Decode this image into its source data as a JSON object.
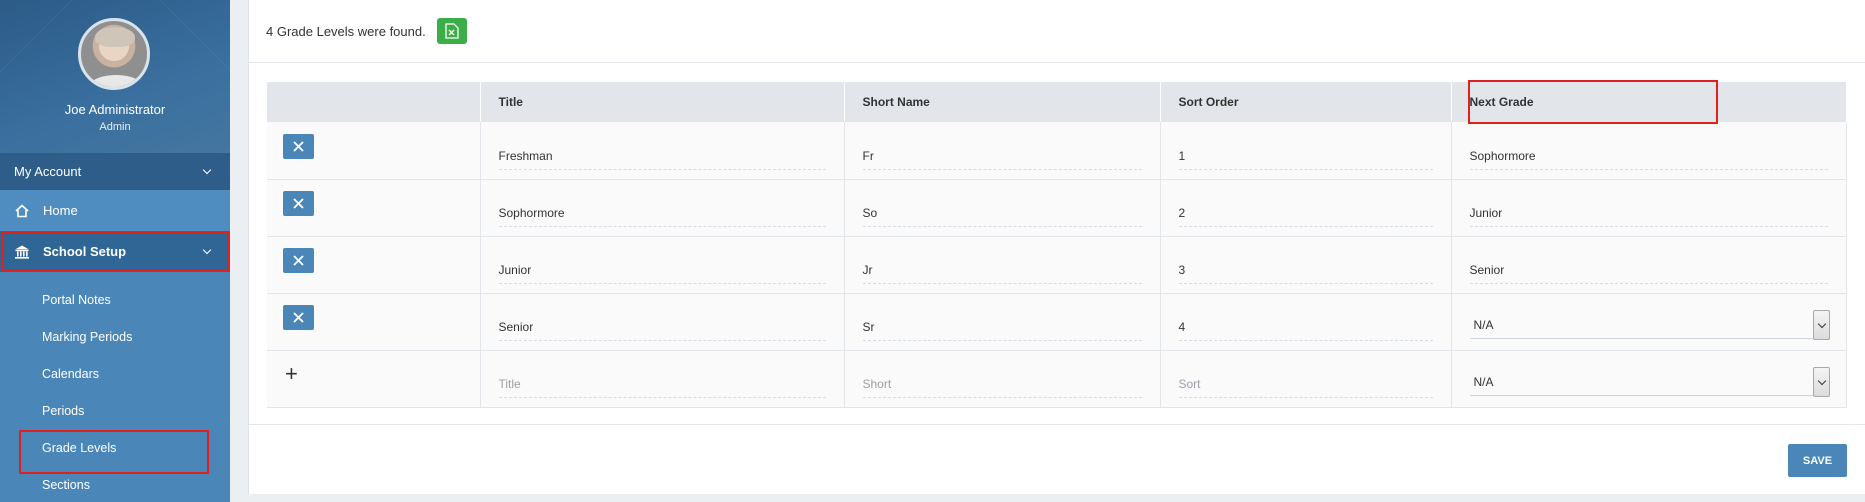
{
  "user": {
    "name": "Joe Administrator",
    "role": "Admin"
  },
  "sidebar": {
    "my_account": "My Account",
    "home": "Home",
    "school_setup": "School Setup",
    "sub_items": [
      "Portal Notes",
      "Marking Periods",
      "Calendars",
      "Periods",
      "Grade Levels",
      "Sections"
    ]
  },
  "main": {
    "found_text": "4 Grade Levels were found.",
    "headers": [
      "Title",
      "Short Name",
      "Sort Order",
      "Next Grade"
    ],
    "rows": [
      {
        "title": "Freshman",
        "short": "Fr",
        "sort": "1",
        "next": "Sophormore"
      },
      {
        "title": "Sophormore",
        "short": "So",
        "sort": "2",
        "next": "Junior"
      },
      {
        "title": "Junior",
        "short": "Jr",
        "sort": "3",
        "next": "Senior"
      },
      {
        "title": "Senior",
        "short": "Sr",
        "sort": "4",
        "next": "N/A"
      }
    ],
    "new_row": {
      "title_placeholder": "Title",
      "short_placeholder": "Short",
      "sort_placeholder": "Sort",
      "next_value": "N/A"
    },
    "save_label": "SAVE"
  },
  "colors": {
    "accent": "#4a86b8",
    "sidebar_dark": "#2d5d88",
    "excel": "#3cae47",
    "highlight": "#e0201e"
  }
}
